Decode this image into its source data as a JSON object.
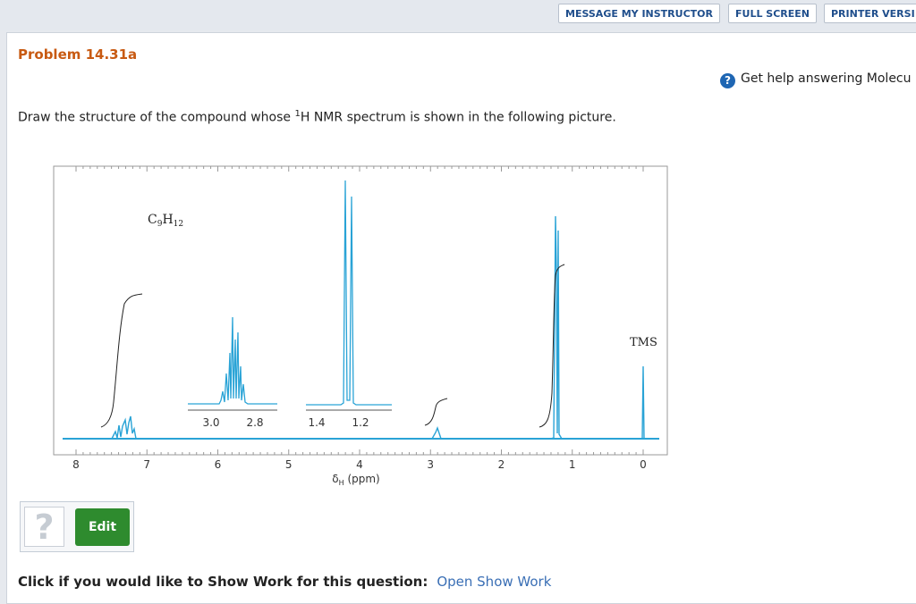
{
  "toolbar": {
    "message_instructor": "MESSAGE MY INSTRUCTOR",
    "full_screen": "FULL SCREEN",
    "printer_version": "PRINTER VERSI"
  },
  "problem": {
    "title": "Problem 14.31a",
    "help_text": "Get help answering Molecu",
    "question_pre": "Draw the structure of the compound whose ",
    "question_sup": "1",
    "question_post": "H NMR spectrum is shown in the following picture."
  },
  "spectrum": {
    "formula_base": "C",
    "formula_sub1": "9",
    "formula_mid": "H",
    "formula_sub2": "12",
    "tms_label": "TMS",
    "axis_label_main": "δ",
    "axis_label_sub": "H",
    "axis_label_unit": " (ppm)",
    "x_ticks": [
      "8",
      "7",
      "6",
      "5",
      "4",
      "3",
      "2",
      "1",
      "0"
    ],
    "inset1_ticks": [
      "3.0",
      "2.8"
    ],
    "inset2_ticks": [
      "1.4",
      "1.2"
    ],
    "line_color": "#29a3d6"
  },
  "answer": {
    "placeholder_glyph": "?",
    "edit_label": "Edit"
  },
  "footer": {
    "text": "Click if you would like to Show Work for this question:",
    "link": "Open Show Work"
  }
}
